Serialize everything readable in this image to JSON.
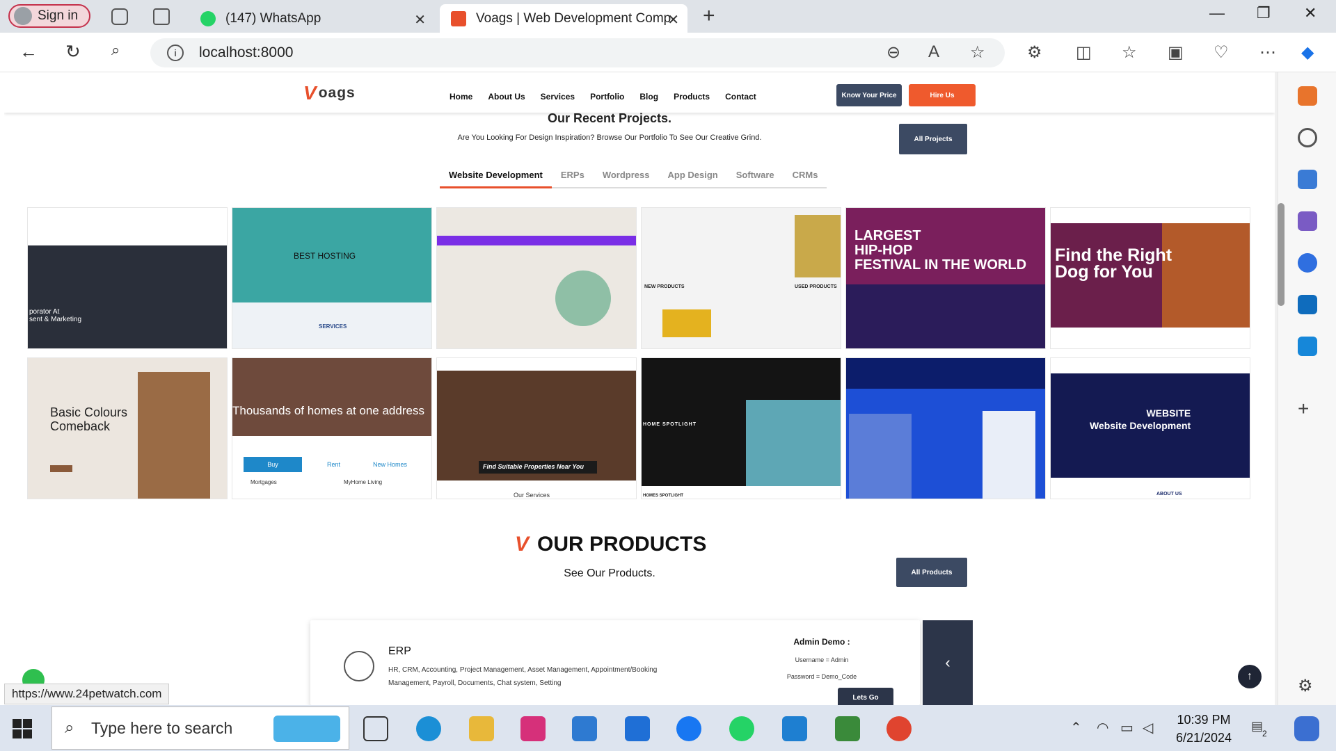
{
  "browser": {
    "sign_in": "Sign in",
    "tabs": [
      {
        "title": "(147) WhatsApp"
      },
      {
        "title": "Voags | Web Development Comp"
      }
    ],
    "new_tab_icon": "+",
    "window_controls": {
      "minimize": "—",
      "restore": "❐",
      "close": "✕"
    },
    "address": "localhost:8000",
    "status_url": "https://www.24petwatch.com"
  },
  "site": {
    "logo_text": "oags",
    "menu": [
      "Home",
      "About Us",
      "Services",
      "Portfolio",
      "Blog",
      "Products",
      "Contact"
    ],
    "know_your_price": "Know Your Price",
    "hire_us": "Hire Us"
  },
  "recent": {
    "title": "Our Recent Projects.",
    "subtitle": "Are You Looking For Design Inspiration? Browse Our Portfolio To See Our Creative Grind.",
    "all_projects": "All Projects",
    "tabs": [
      "Website Development",
      "ERPs",
      "Wordpress",
      "App Design",
      "Software",
      "CRMs"
    ],
    "shots": [
      {
        "caption": "porator At\nsent & Marketing",
        "bg": "#2a2f3a"
      },
      {
        "caption": "BEST HOSTING",
        "bg": "#3ba6a3",
        "sub": "SERVICES"
      },
      {
        "caption": "",
        "bg": "#ece8e2"
      },
      {
        "caption": "NEW PRODUCTS",
        "caption2": "USED PRODUCTS",
        "bg": "#f3f3f3"
      },
      {
        "caption": "LARGEST\nHIP-HOP\nFESTIVAL IN THE WORLD",
        "bg": "#7a1f5c"
      },
      {
        "caption": "Find the Right\nDog for You",
        "bg": "#6b1f4b"
      },
      {
        "caption": "Basic Colours\nComeback",
        "bg": "#ece6df"
      },
      {
        "caption": "Thousands of homes at one address",
        "bg": "#6e4a3c",
        "buttons": [
          "Buy",
          "Rent",
          "New Homes"
        ],
        "items": [
          "Mortgages",
          "MyHome Living"
        ]
      },
      {
        "caption": "Find Suitable Properties Near You",
        "bg": "#5a3b2a",
        "sub": "Our Services"
      },
      {
        "caption": "HOME SPOTLIGHT",
        "bg": "#141414",
        "sub": "HOMES SPOTLIGHT"
      },
      {
        "caption": "",
        "bg": "#1d4fd6"
      },
      {
        "caption": "WEBSITE\nWebsite Development",
        "bg": "#141a52",
        "sub": "ABOUT US"
      }
    ]
  },
  "products": {
    "title": "OUR PRODUCTS",
    "subtitle": "See Our Products.",
    "all_products": "All Products",
    "erp": {
      "title": "ERP",
      "description": "HR, CRM, Accounting, Project Management, Asset Management, Appointment/Booking Management, Payroll, Documents, Chat system, Setting",
      "admin_title": "Admin Demo :",
      "username": "Username = Admin",
      "password": "Password = Demo_Code",
      "lets_go": "Lets Go",
      "nav_icon": "‹"
    },
    "back_to_top_icon": "↑"
  },
  "taskbar": {
    "search_placeholder": "Type here to search",
    "time": "10:39 PM",
    "date": "6/21/2024",
    "notification_count": "2"
  },
  "colors": {
    "accent": "#e8502c",
    "navy": "#3c4a63",
    "dark": "#2c3549"
  }
}
